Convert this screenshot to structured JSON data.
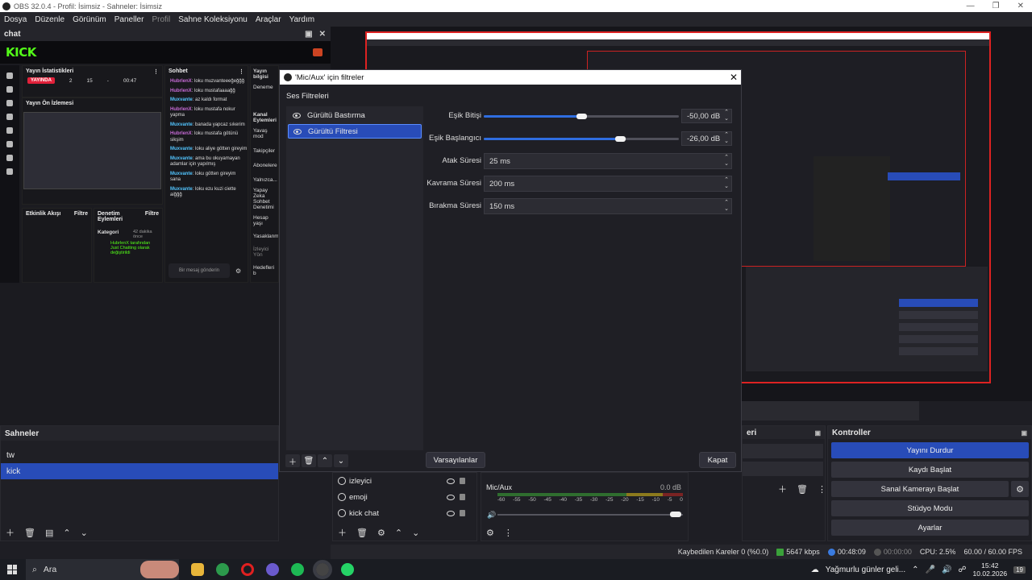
{
  "window_title": "OBS 32.0.4 - Profil: İsimsiz - Sahneler: İsimsiz",
  "menu": [
    "Dosya",
    "Düzenle",
    "Görünüm",
    "Paneller",
    "Profil",
    "Sahne Koleksiyonu",
    "Araçlar",
    "Yardım"
  ],
  "chat_dock": {
    "title": "chat",
    "logo": "KICK",
    "stream_stats_title": "Yayın İstatistikleri",
    "live_badge": "YAYINDA",
    "stat_viewers": "2",
    "stat_followers": "15",
    "stat_dash": "-",
    "stat_time": "00:47",
    "preview_title": "Yayın Ön İzlemesi",
    "chat_title": "Sohbet",
    "info_title": "Yayın bilgisi",
    "info_item": "Deneme",
    "messages": [
      {
        "user": "HubrlenX",
        "text": "loku muzvanteeeğeğğğ"
      },
      {
        "user": "HubrlenX",
        "text": "loku mustafaaaağğ"
      },
      {
        "user": "Muxvante",
        "text": "az kaldı format"
      },
      {
        "user": "HubrlenX",
        "text": "loku mustafa nokur yapma"
      },
      {
        "user": "Muxvante",
        "text": "banada yapcaz sıkerim"
      },
      {
        "user": "HubrlenX",
        "text": "loku mustafa götünü sikşim"
      },
      {
        "user": "Muxvante",
        "text": "loku aliye götten gireyim"
      },
      {
        "user": "Muxvante",
        "text": "ama bu okuyamayan adamlar için yapılmış"
      },
      {
        "user": "Muxvante",
        "text": "loku götten gireyim sana"
      },
      {
        "user": "Muxvante",
        "text": "loku ezu kuzi ciette aiğğğ"
      }
    ],
    "chat_placeholder": "Bir mesaj gönderin",
    "side_items": [
      "Kanal Eylemleri",
      "Yavaş mod",
      "Takipçiler",
      "Abonelere",
      "Yalnızca...",
      "Yapay Zeka Sohbet Denetimi",
      "Hesap yaşı",
      "Yasaklanm",
      "İzleyici Yön",
      "Hedefleri b"
    ],
    "activity_title": "Etkinlik Akışı",
    "filter_label": "Filtre",
    "mod_title": "Denetim Eylemleri",
    "category_label": "Kategori",
    "category_time": "42 dakika önce",
    "category_text": "HubrlenX tarafından Just Chatting olarak değiştirildi"
  },
  "dialog": {
    "title": "'Mic/Aux' için filtreler",
    "section": "Ses Filtreleri",
    "filters": [
      "Gürültü Bastırma",
      "Gürültü Filtresi"
    ],
    "selected_filter": 1,
    "params": [
      {
        "label": "Eşik Bitişi",
        "value": "-50,00 dB",
        "level": 0.5
      },
      {
        "label": "Eşik Başlangıcı",
        "value": "-26,00 dB",
        "level": 0.7
      },
      {
        "label": "Atak Süresi",
        "value": "25 ms"
      },
      {
        "label": "Kavrama Süresi",
        "value": "200 ms"
      },
      {
        "label": "Bırakma Süresi",
        "value": "150 ms"
      }
    ],
    "defaults_button": "Varsayılanlar",
    "close_button": "Kapat"
  },
  "scenes": {
    "title": "Sahneler",
    "items": [
      "tw",
      "kick"
    ],
    "selected": 1
  },
  "sources": {
    "items": [
      "izleyici",
      "emoji",
      "kick chat"
    ]
  },
  "mixer": {
    "channel": "Mic/Aux",
    "level": "0.0 dB",
    "ticks": [
      "-60",
      "-55",
      "-50",
      "-45",
      "-40",
      "-35",
      "-30",
      "-25",
      "-20",
      "-15",
      "-10",
      "-5",
      "0"
    ]
  },
  "transitions": {
    "title_fragment": "eri"
  },
  "controls": {
    "title": "Kontroller",
    "buttons": [
      "Yayını Durdur",
      "Kaydı Başlat",
      "Sanal Kamerayı Başlat",
      "Stüdyo Modu",
      "Ayarlar"
    ]
  },
  "status": {
    "dropped": "Kaybedilen Kareler 0 (%0.0)",
    "bitrate": "5647 kbps",
    "stream_time": "00:48:09",
    "rec_time": "00:00:00",
    "cpu": "CPU: 2.5%",
    "fps": "60.00 / 60.00 FPS"
  },
  "taskbar": {
    "search": "Ara",
    "weather": "Yağmurlu günler geli...",
    "time": "15:42",
    "date": "10.02.2026",
    "notif": "19"
  },
  "colors": {
    "accent": "#284cb8",
    "kick_green": "#53fc18",
    "live_red": "#e1213a"
  }
}
